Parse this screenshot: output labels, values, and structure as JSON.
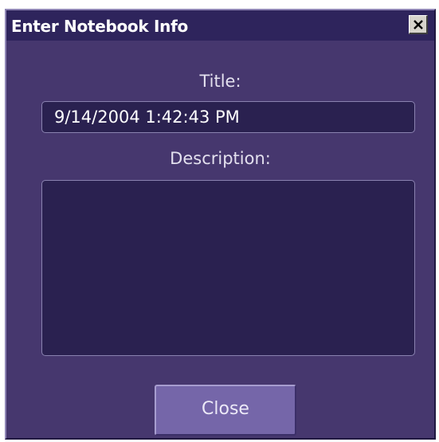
{
  "window": {
    "title": "Enter Notebook Info"
  },
  "form": {
    "title_label": "Title:",
    "title_value": "9/14/2004 1:42:43 PM",
    "description_label": "Description:",
    "description_value": ""
  },
  "buttons": {
    "close_label": "Close"
  },
  "icons": {
    "titlebar_close": "close-x-icon"
  },
  "colors": {
    "dialog_background": "#46376e",
    "titlebar_background": "#2e245c",
    "field_background": "#2a2150",
    "button_background": "#7566a9"
  }
}
